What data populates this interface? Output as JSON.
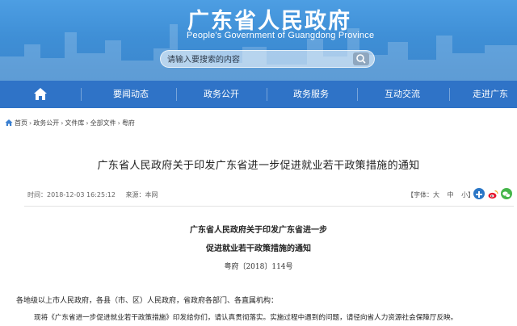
{
  "header": {
    "title": "广东省人民政府",
    "subtitle": "People's Government of Guangdong Province",
    "search_placeholder": "请输入要搜索的内容"
  },
  "nav": {
    "items": [
      {
        "label": "要闻动态"
      },
      {
        "label": "政务公开"
      },
      {
        "label": "政务服务"
      },
      {
        "label": "互动交流"
      },
      {
        "label": "走进广东"
      }
    ]
  },
  "breadcrumb": [
    "首页",
    "政务公开",
    "文件库",
    "全部文件",
    "粤府"
  ],
  "article": {
    "title": "广东省人民政府关于印发广东省进一步促进就业若干政策措施的通知",
    "time": "时间：2018-12-03 16:25:12",
    "source": "来源：本网",
    "font_label": "【字体：大",
    "font_medium": "中",
    "font_small": "小】"
  },
  "document": {
    "heading1": "广东省人民政府关于印发广东省进一步",
    "heading2": "促进就业若干政策措施的通知",
    "number": "粤府〔2018〕114号",
    "para1": "各地级以上市人民政府，各县（市、区）人民政府，省政府各部门、各直属机构：",
    "para2": "现将《广东省进一步促进就业若干政策措施》印发给你们，请认真贯彻落实。实施过程中遇到的问题，请径向省人力资源社会保障厅反映。"
  },
  "colors": {
    "banner": "#3f8fd6",
    "nav": "#2f73c7",
    "weibo": "#e6162d",
    "wechat": "#44b549",
    "plus": "#2a76c6"
  }
}
